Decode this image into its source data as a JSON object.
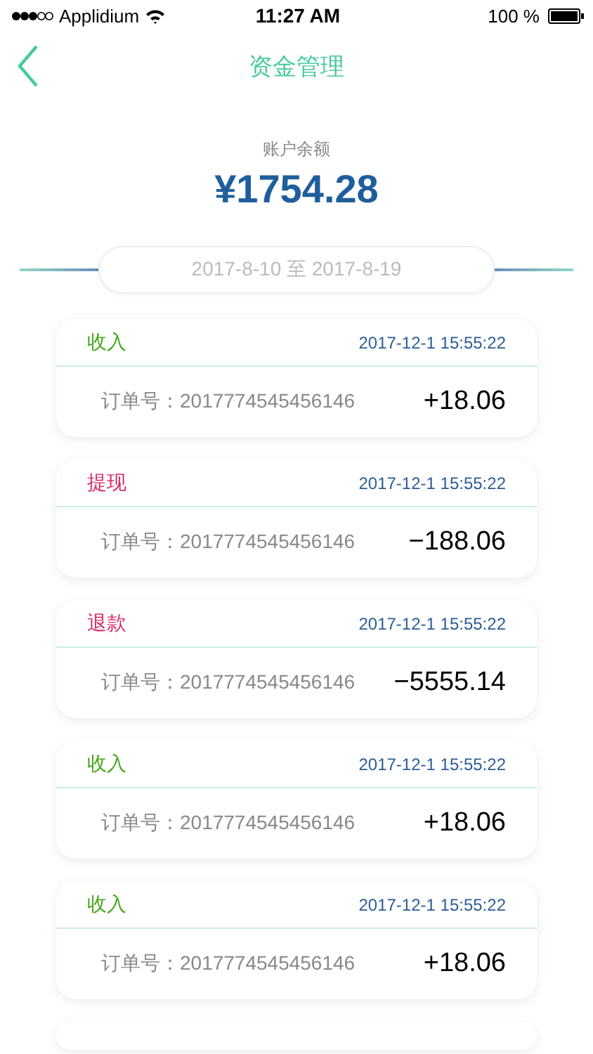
{
  "status_bar": {
    "carrier": "Applidium",
    "time": "11:27 AM",
    "battery": "100 %"
  },
  "nav": {
    "title": "资金管理"
  },
  "balance": {
    "label": "账户余额",
    "amount": "¥1754.28"
  },
  "date_range": {
    "text": "2017-8-10 至 2017-8-19"
  },
  "records": [
    {
      "kind": "income",
      "type": "收入",
      "time": "2017-12-1 15:55:22",
      "order": "订单号：2017774545456146",
      "amount": "+18.06"
    },
    {
      "kind": "withdraw",
      "type": "提现",
      "time": "2017-12-1 15:55:22",
      "order": "订单号：2017774545456146",
      "amount": "−188.06"
    },
    {
      "kind": "refund",
      "type": "退款",
      "time": "2017-12-1 15:55:22",
      "order": "订单号：2017774545456146",
      "amount": "−5555.14"
    },
    {
      "kind": "income",
      "type": "收入",
      "time": "2017-12-1 15:55:22",
      "order": "订单号：2017774545456146",
      "amount": "+18.06"
    },
    {
      "kind": "income",
      "type": "收入",
      "time": "2017-12-1 15:55:22",
      "order": "订单号：2017774545456146",
      "amount": "+18.06"
    }
  ]
}
